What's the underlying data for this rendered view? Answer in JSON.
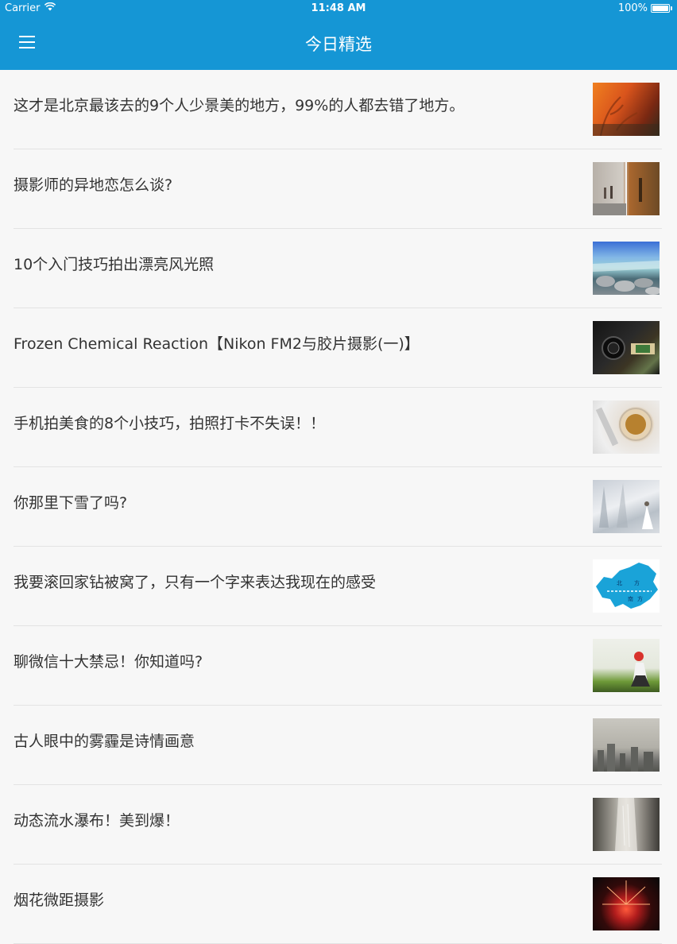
{
  "status_bar": {
    "carrier": "Carrier",
    "time": "11:48 AM",
    "battery_text": "100%",
    "battery_level": 1.0
  },
  "nav": {
    "title": "今日精选",
    "menu_icon": "hamburger-menu-icon"
  },
  "colors": {
    "header_bg": "#1596d5",
    "page_bg": "#f7f7f7",
    "title_text": "#333333",
    "divider": "#e3e3e3"
  },
  "articles": [
    {
      "title": "这才是北京最该去的9个人少景美的地方，99%的人都去错了地方。",
      "thumb": "red-wall-tree-shadow-photo"
    },
    {
      "title": "摄影师的异地恋怎么谈?",
      "thumb": "split-couple-street-photo"
    },
    {
      "title": "10个入门技巧拍出漂亮风光照",
      "thumb": "river-stones-landscape-photo"
    },
    {
      "title": "Frozen Chemical Reaction【Nikon FM2与胶片摄影(一)】",
      "thumb": "camera-lens-film-photo"
    },
    {
      "title": "手机拍美食的8个小技巧，拍照打卡不失误！！",
      "thumb": "noodle-bowl-food-photo"
    },
    {
      "title": "你那里下雪了吗?",
      "thumb": "snowy-forest-bride-photo"
    },
    {
      "title": "我要滚回家钻被窝了，只有一个字来表达我现在的感受",
      "thumb": "china-map-north-south",
      "map_labels": [
        "北",
        "方",
        "南",
        "方"
      ]
    },
    {
      "title": "聊微信十大禁忌！你知道吗?",
      "thumb": "girl-red-hat-field-photo"
    },
    {
      "title": "古人眼中的雾霾是诗情画意",
      "thumb": "smog-city-skyline-photo"
    },
    {
      "title": "动态流水瀑布！美到爆！",
      "thumb": "waterfall-long-exposure-photo"
    },
    {
      "title": "烟花微距摄影",
      "thumb": "fireworks-macro-photo"
    }
  ]
}
